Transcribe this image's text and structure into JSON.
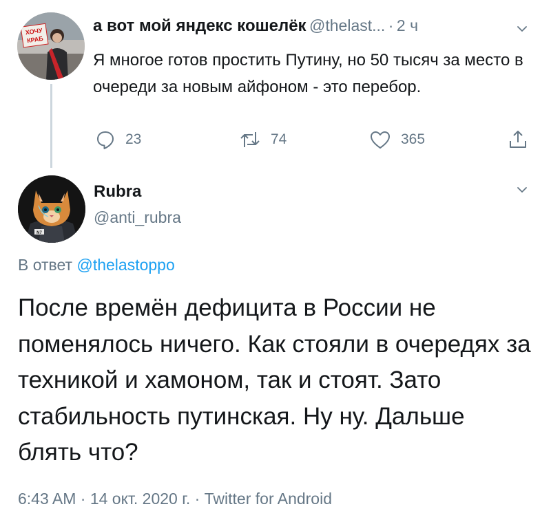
{
  "parent_tweet": {
    "author_name": "а вот мой яндекс кошелёк",
    "author_handle": "@thelast...",
    "separator": "·",
    "time": "2 ч",
    "text": "Я многое готов простить Путину, но 50 тысяч за место в очереди за новым айфоном - это перебор.",
    "avatar_sign_text": "ХОЧУ КРАБ",
    "replies": "23",
    "retweets": "74",
    "likes": "365"
  },
  "reply_tweet": {
    "author_name": "Rubra",
    "author_handle": "@anti_rubra",
    "avatar_badge": "N7",
    "reply_prefix": "В ответ",
    "reply_to_handle": "@thelastoppo",
    "text": "После времён дефицита в России не поменялось ничего. Как стояли в очередях за техникой и хамоном, так и стоят. Зато стабильность путинская. Ну ну. Дальше блять что?",
    "meta": "6:43 AM · 14 окт. 2020 г. · Twitter for Android"
  },
  "icons": {
    "reply": "reply-icon",
    "retweet": "retweet-icon",
    "like": "heart-icon",
    "share": "share-icon",
    "more": "chevron-down-icon"
  },
  "colors": {
    "text": "#14171a",
    "secondary": "#657786",
    "link": "#1da1f2",
    "thread_line": "#ccd6dd"
  }
}
